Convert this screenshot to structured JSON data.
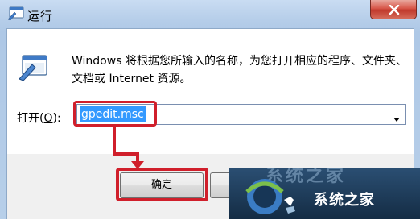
{
  "window": {
    "title": "运行",
    "close_icon": "close-icon",
    "run_icon": "run-program-icon"
  },
  "dialog": {
    "description": "Windows 将根据您所输入的名称，为您打开相应的程序、文件夹、文档或 Internet 资源。",
    "open_label_prefix": "打开(",
    "open_label_key": "O",
    "open_label_suffix": "):",
    "command_value": "gpedit.msc",
    "ok_label": "确定"
  },
  "watermark": {
    "text": "系统之家",
    "faded_text": "系统之家"
  },
  "colors": {
    "highlight_red": "#d01f2b",
    "selection_blue": "#3399ff"
  }
}
